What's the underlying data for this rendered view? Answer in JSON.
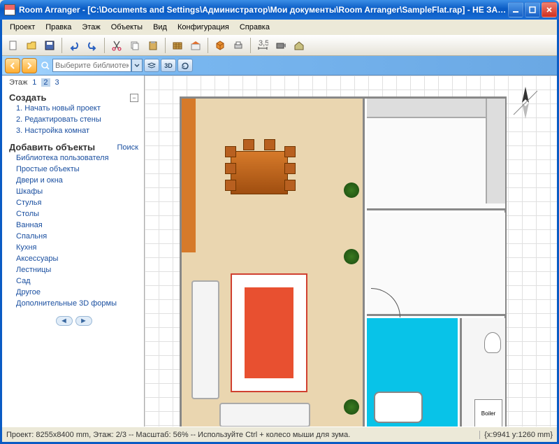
{
  "title": "Room Arranger - [C:\\Documents and Settings\\Администратор\\Мои документы\\Room Arranger\\SampleFlat.rap] - НЕ ЗАРЕГИСТРИРО…",
  "menu": [
    "Проект",
    "Правка",
    "Этаж",
    "Объекты",
    "Вид",
    "Конфигурация",
    "Справка"
  ],
  "library_search_placeholder": "Выберите библиотеку...",
  "secbar_3d": "3D",
  "sidebar": {
    "floor_label": "Этаж",
    "floors": [
      "1",
      "2",
      "3"
    ],
    "floor_selected_index": 1,
    "create": {
      "title": "Создать",
      "items": [
        "1. Начать новый проект",
        "2. Редактировать стены",
        "3. Настройка комнат"
      ]
    },
    "add": {
      "title": "Добавить объекты",
      "search_label": "Поиск",
      "items": [
        "Библиотека пользователя",
        "Простые объекты",
        "Двери и окна",
        "Шкафы",
        "Стулья",
        "Столы",
        "Ванная",
        "Спальня",
        "Кухня",
        "Аксессуары",
        "Лестницы",
        "Сад",
        "Другое",
        "Дополнительные 3D формы"
      ]
    }
  },
  "boiler_label": "Boiler",
  "statusbar": {
    "left": "Проект: 8255x8400 mm,  Этаж: 2/3  --  Масштаб: 56%  --  Используйте Ctrl + колесо мыши для зума.",
    "right": "{x:9941 y:1260 mm}"
  }
}
